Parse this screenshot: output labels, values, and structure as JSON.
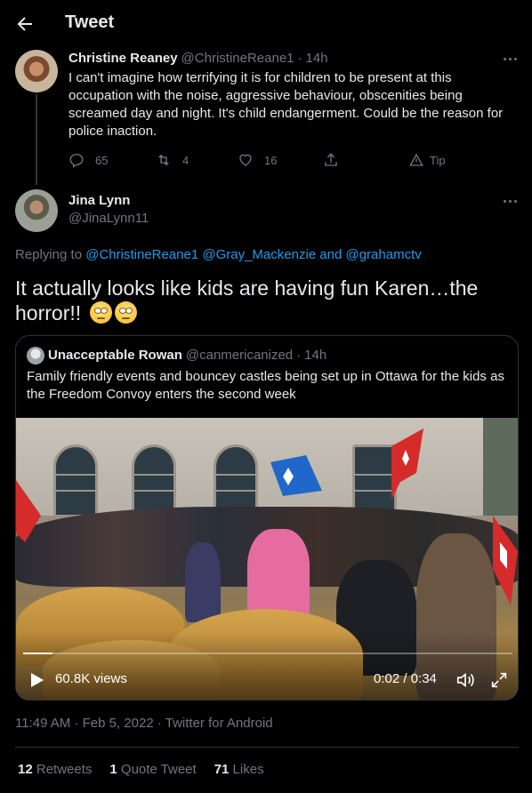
{
  "header": {
    "title": "Tweet"
  },
  "parent_tweet": {
    "name": "Christine Reaney",
    "handle": "@ChristineReane1",
    "time": "14h",
    "text": "I can't imagine how terrifying it is for children to be present at this occupation with the noise, aggressive behaviour, obscenities being screamed day and night. It's child endangerment. Could be the reason for police inaction.",
    "replies": "65",
    "retweets": "4",
    "likes": "16",
    "tip_label": "Tip"
  },
  "main_tweet": {
    "name": "Jina Lynn",
    "handle": "@JinaLynn11",
    "replying_prefix": "Replying to",
    "replying_to": "@ChristineReane1 @Gray_Mackenzie and @grahamctv",
    "text": "It actually looks like kids are having fun Karen…the horror!!",
    "emojis": [
      "face-with-rolling-eyes",
      "face-with-rolling-eyes"
    ]
  },
  "quote": {
    "name": "Unacceptable Rowan",
    "handle": "@canmericanized",
    "time": "14h",
    "text": "Family friendly events and bouncey castles being set up in Ottawa for the kids as the Freedom Convoy enters the second week",
    "video": {
      "views": "60.8K views",
      "time": "0:02 / 0:34",
      "progress": 0.06
    }
  },
  "meta": {
    "time": "11:49 AM",
    "date": "Feb 5, 2022",
    "source": "Twitter for Android"
  },
  "stats": {
    "retweets_count": "12",
    "retweets_label": "Retweets",
    "quotes_count": "1",
    "quotes_label": "Quote Tweet",
    "likes_count": "71",
    "likes_label": "Likes"
  },
  "colors": {
    "accent": "#1d9bf0",
    "background": "#000000",
    "muted": "#71767b"
  }
}
